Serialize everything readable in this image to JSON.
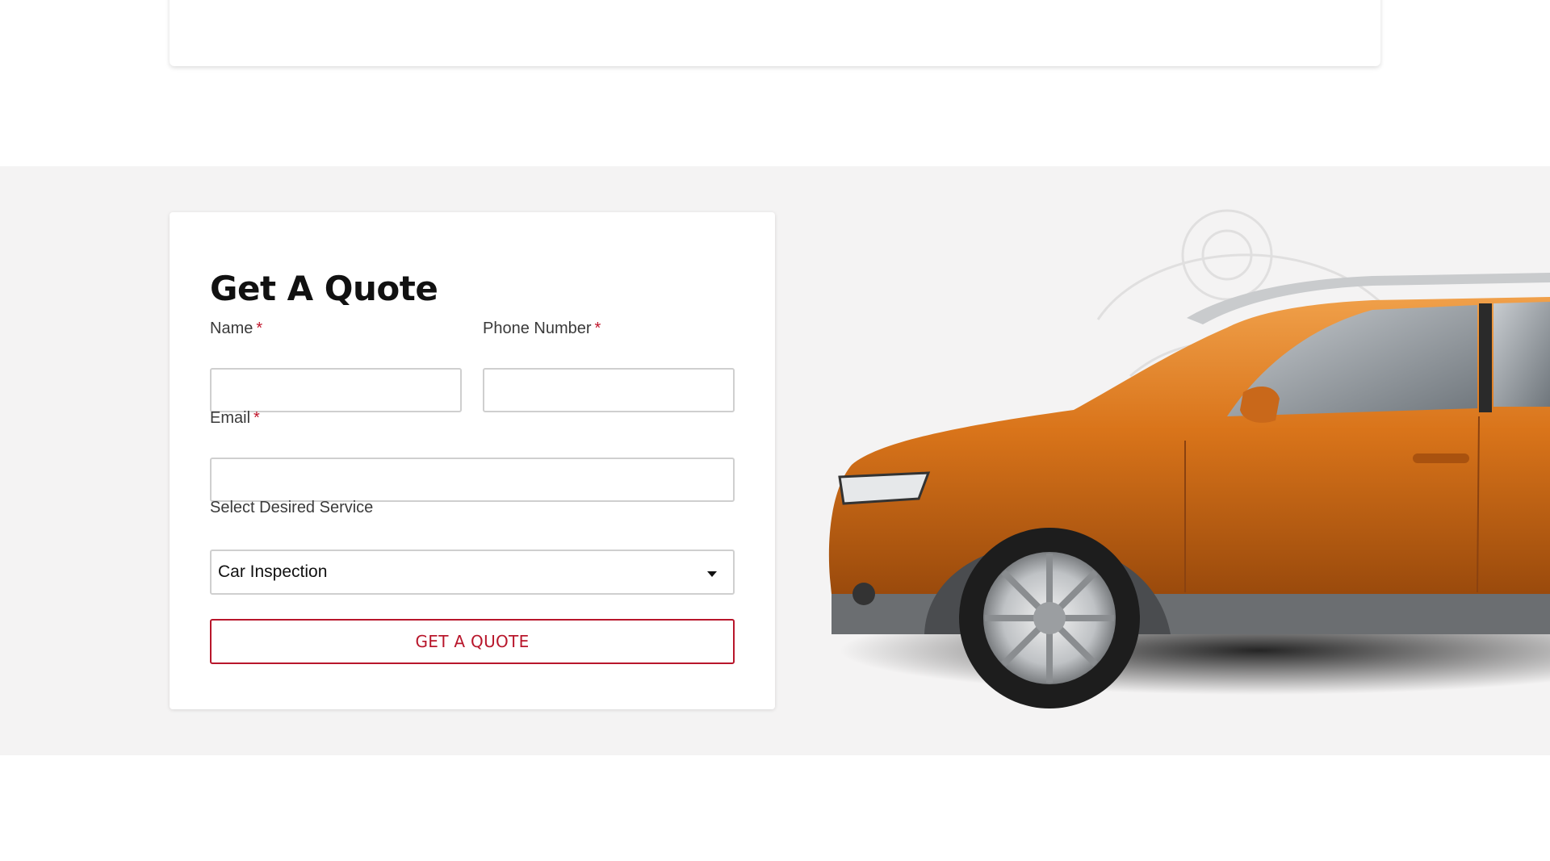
{
  "quote_form": {
    "title": "Get A Quote",
    "name_label": "Name",
    "phone_label": "Phone Number",
    "email_label": "Email",
    "required_mark": "*",
    "name_value": "",
    "phone_value": "",
    "email_value": "",
    "service_label": "Select Desired Service",
    "service_selected": "Car Inspection",
    "submit_label": "GET A QUOTE"
  },
  "car_image": {
    "icon": "orange-suv-image"
  },
  "colors": {
    "accent": "#b8162b",
    "required": "#c0152b",
    "section_bg": "#f4f3f3",
    "car_body": "#d9741a"
  }
}
